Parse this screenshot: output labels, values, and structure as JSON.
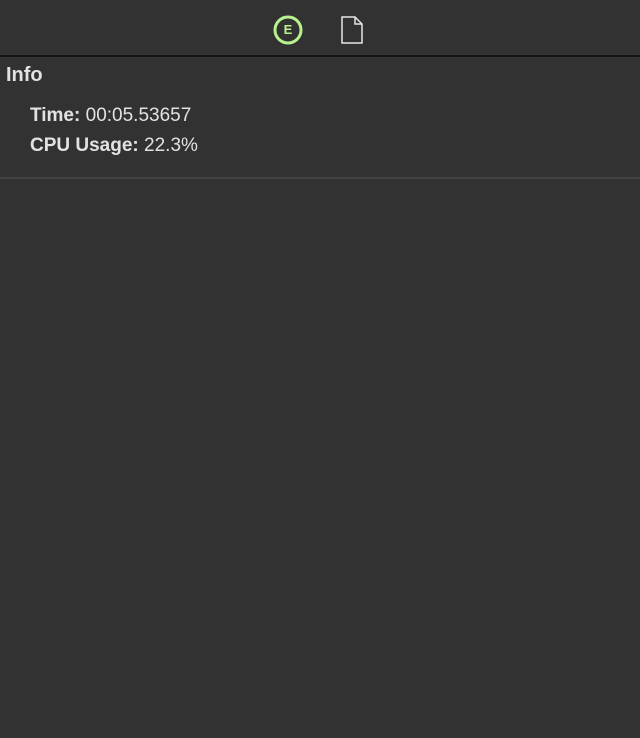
{
  "toolbar": {
    "buttons": [
      {
        "name": "engine-tab",
        "glyph": "E",
        "icon": "engine-icon",
        "accent": "#b8f28e"
      },
      {
        "name": "document-tab",
        "icon": "document-icon"
      }
    ]
  },
  "info": {
    "title": "Info",
    "time_label": "Time:",
    "time_value": "00:05.53657",
    "cpu_label": "CPU Usage:",
    "cpu_value": "22.3%"
  },
  "colors": {
    "background": "#323232",
    "divider": "#151515",
    "section_divider": "#434343",
    "text": "#e2e2e2",
    "accent": "#b8f28e"
  }
}
